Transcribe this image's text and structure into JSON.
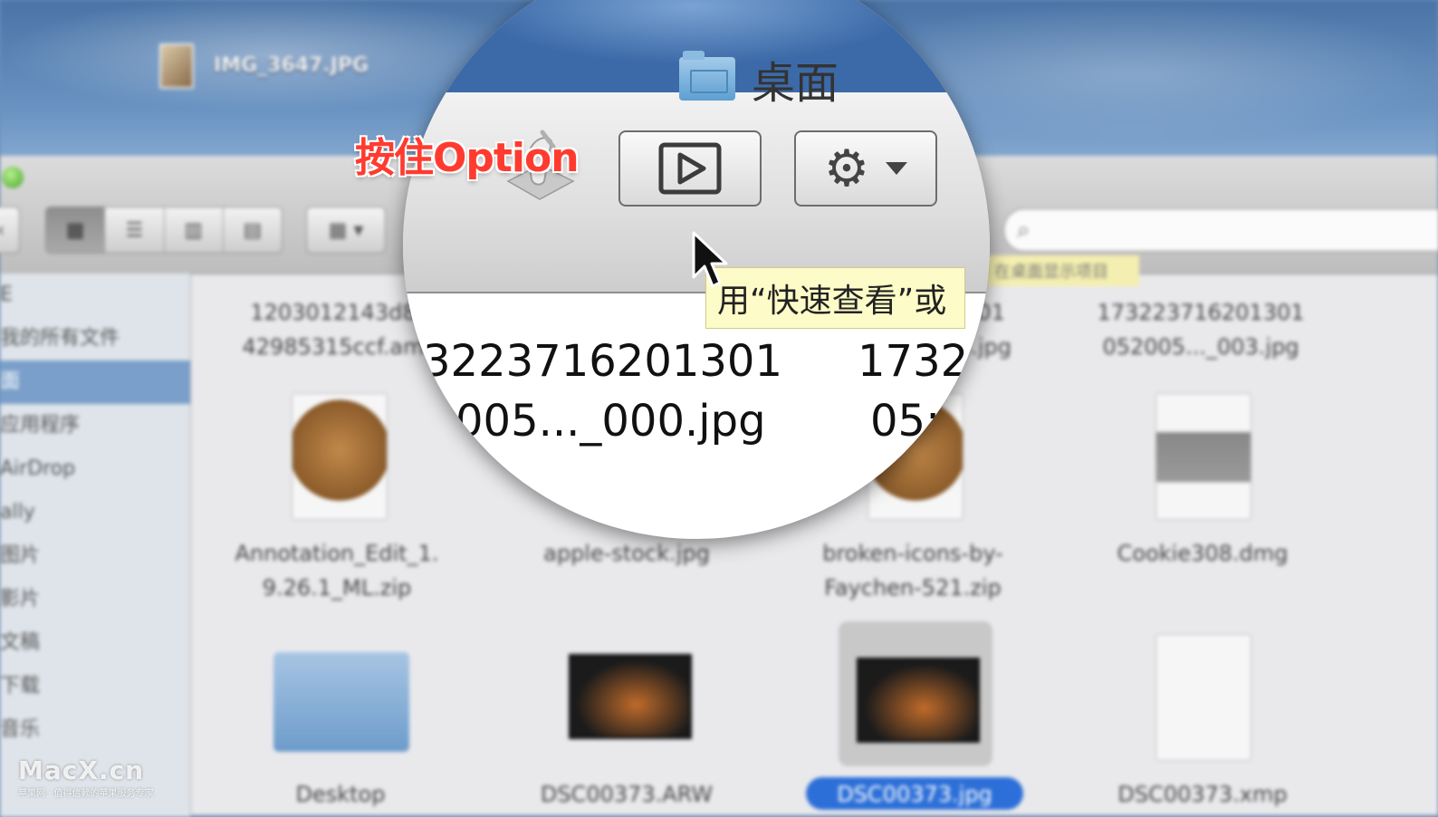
{
  "desktop": {
    "file_label": "IMG_3647.JPG"
  },
  "finder_toolbar": {
    "view_icons": [
      "icon-view-icon",
      "list-view-icon",
      "column-view-icon",
      "coverflow-view-icon"
    ],
    "arrange_icon": "arrange-menu-icon",
    "search_icon": "search-icon"
  },
  "background_tooltip": "在桌面显示项目",
  "sidebar": {
    "items": [
      {
        "label": "E"
      },
      {
        "label": "我的所有文件"
      },
      {
        "label": "面"
      },
      {
        "label": "应用程序"
      },
      {
        "label": "AirDrop"
      },
      {
        "label": "ally"
      },
      {
        "label": "图片"
      },
      {
        "label": "影片"
      },
      {
        "label": "文稿"
      },
      {
        "label": "下载"
      },
      {
        "label": "音乐"
      }
    ],
    "selected_index": 2
  },
  "files": [
    {
      "name_line1": "1203012143d8",
      "name_line2": "42985315ccf.am"
    },
    {
      "name_line1": "…301",
      "name_line2": "…4.jpg"
    },
    {
      "name_line1": "173223716201301",
      "name_line2": "052005..._003.jpg"
    },
    {
      "name_line1": "Annotation_Edit_1.",
      "name_line2": "9.26.1_ML.zip"
    },
    {
      "name_line1": "apple-stock.jpg",
      "name_line2": ""
    },
    {
      "name_line1": "broken-icons-by-",
      "name_line2": "Faychen-521.zip"
    },
    {
      "name_line1": "Cookie308.dmg",
      "name_line2": ""
    },
    {
      "name_line1": "Desktop",
      "name_line2": ""
    },
    {
      "name_line1": "DSC00373.ARW",
      "name_line2": ""
    },
    {
      "name_line1": "DSC00373.jpg",
      "name_line2": ""
    },
    {
      "name_line1": "DSC00373.xmp",
      "name_line2": ""
    }
  ],
  "lens": {
    "window_title": "桌面",
    "quicklook_icon": "play-icon",
    "action_icon": "gear-icon",
    "tooltip": "用“快速查看”或",
    "file_a_line1": "3223716201301",
    "file_a_line2": "005..._000.jpg",
    "file_b_line1": "1732",
    "file_b_line2": "05:"
  },
  "hint_label": "按住Option",
  "watermark": {
    "brand": "MacX.cn",
    "tagline": "苹果网 · 值得信赖的苹果服务专家"
  },
  "colors": {
    "hint": "#ff3b2f",
    "selection": "#2c6fd8",
    "tooltip_bg": "#fdfbc7"
  }
}
